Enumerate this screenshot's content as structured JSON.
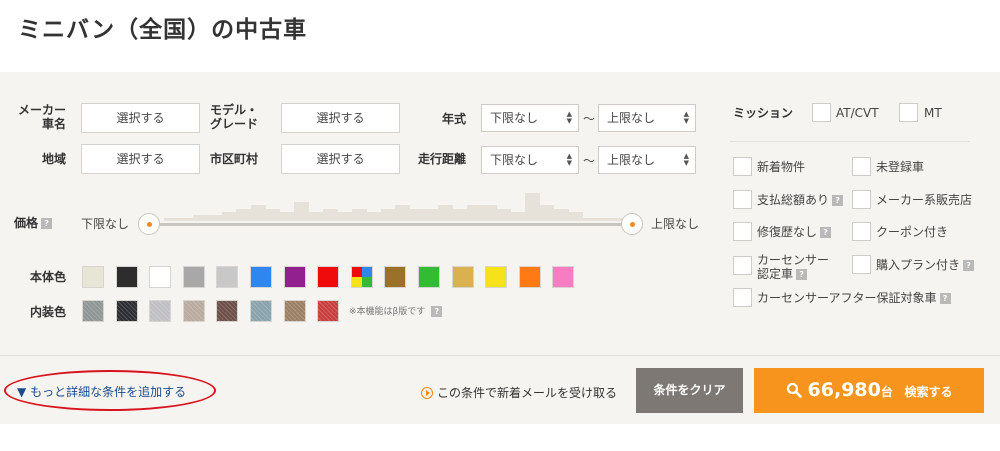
{
  "page": {
    "title": "ミニバン（全国）の中古車"
  },
  "filters": {
    "maker_label_line1": "メーカー",
    "maker_label_line2": "車名",
    "maker_value": "選択する",
    "model_label_line1": "モデル・",
    "model_label_line2": "グレード",
    "model_value": "選択する",
    "region_label": "地域",
    "region_value": "選択する",
    "city_label": "市区町村",
    "city_value": "選択する",
    "year_label": "年式",
    "year_min": "下限なし",
    "year_max": "上限なし",
    "mileage_label": "走行距離",
    "mileage_min": "下限なし",
    "mileage_max": "上限なし",
    "range_sep": "～"
  },
  "price": {
    "label": "価格",
    "min_label": "下限なし",
    "max_label": "上限なし",
    "histogram": [
      1,
      1,
      2,
      2,
      3,
      4,
      5,
      4,
      3,
      6,
      3,
      4,
      3,
      4,
      3,
      4,
      5,
      4,
      4,
      5,
      4,
      5,
      5,
      4,
      3,
      9,
      5,
      4,
      3,
      1,
      1,
      1
    ]
  },
  "help_mark": "?",
  "colors": {
    "body_label": "本体色",
    "body": [
      "#e6e5d6",
      "#2d2d2d",
      "#ffffff",
      "#a8a8a8",
      "#c8c8c8",
      "#2f86ee",
      "#93208f",
      "#ef0b0b",
      "multi",
      "#9a7129",
      "#33bb33",
      "#d9b14e",
      "#f6e21b",
      "#ff7a14",
      "#f77cc2"
    ],
    "interior_label": "内装色",
    "interior": [
      "#8f9696",
      "#2c2e34",
      "#bfc0c4",
      "#b9ab9d",
      "#6d5149",
      "#8aa2ad",
      "#9c8066",
      "#c94040"
    ],
    "beta_note": "※本機能はβ版です"
  },
  "mission": {
    "label": "ミッション",
    "options": [
      "AT/CVT",
      "MT"
    ]
  },
  "options": {
    "new_arrival": "新着物件",
    "unregistered": "未登録車",
    "total_price": "支払総額あり",
    "maker_dealer": "メーカー系販売店",
    "no_repair": "修復歴なし",
    "coupon": "クーポン付き",
    "certified_line1": "カーセンサー",
    "certified_line2": "認定車",
    "purchase_plan": "購入プラン付き",
    "after_warranty": "カーセンサーアフター保証対象車"
  },
  "footer": {
    "more_conditions": "もっと詳細な条件を追加する",
    "more_marker": "▼",
    "mail_subscribe": "この条件で新着メールを受け取る",
    "clear": "条件をクリア",
    "search_count": "66,980",
    "search_unit": "台",
    "search_action": "検索する"
  },
  "accent_colors": {
    "orange": "#f7941d",
    "annotation_red": "#d7141e"
  }
}
